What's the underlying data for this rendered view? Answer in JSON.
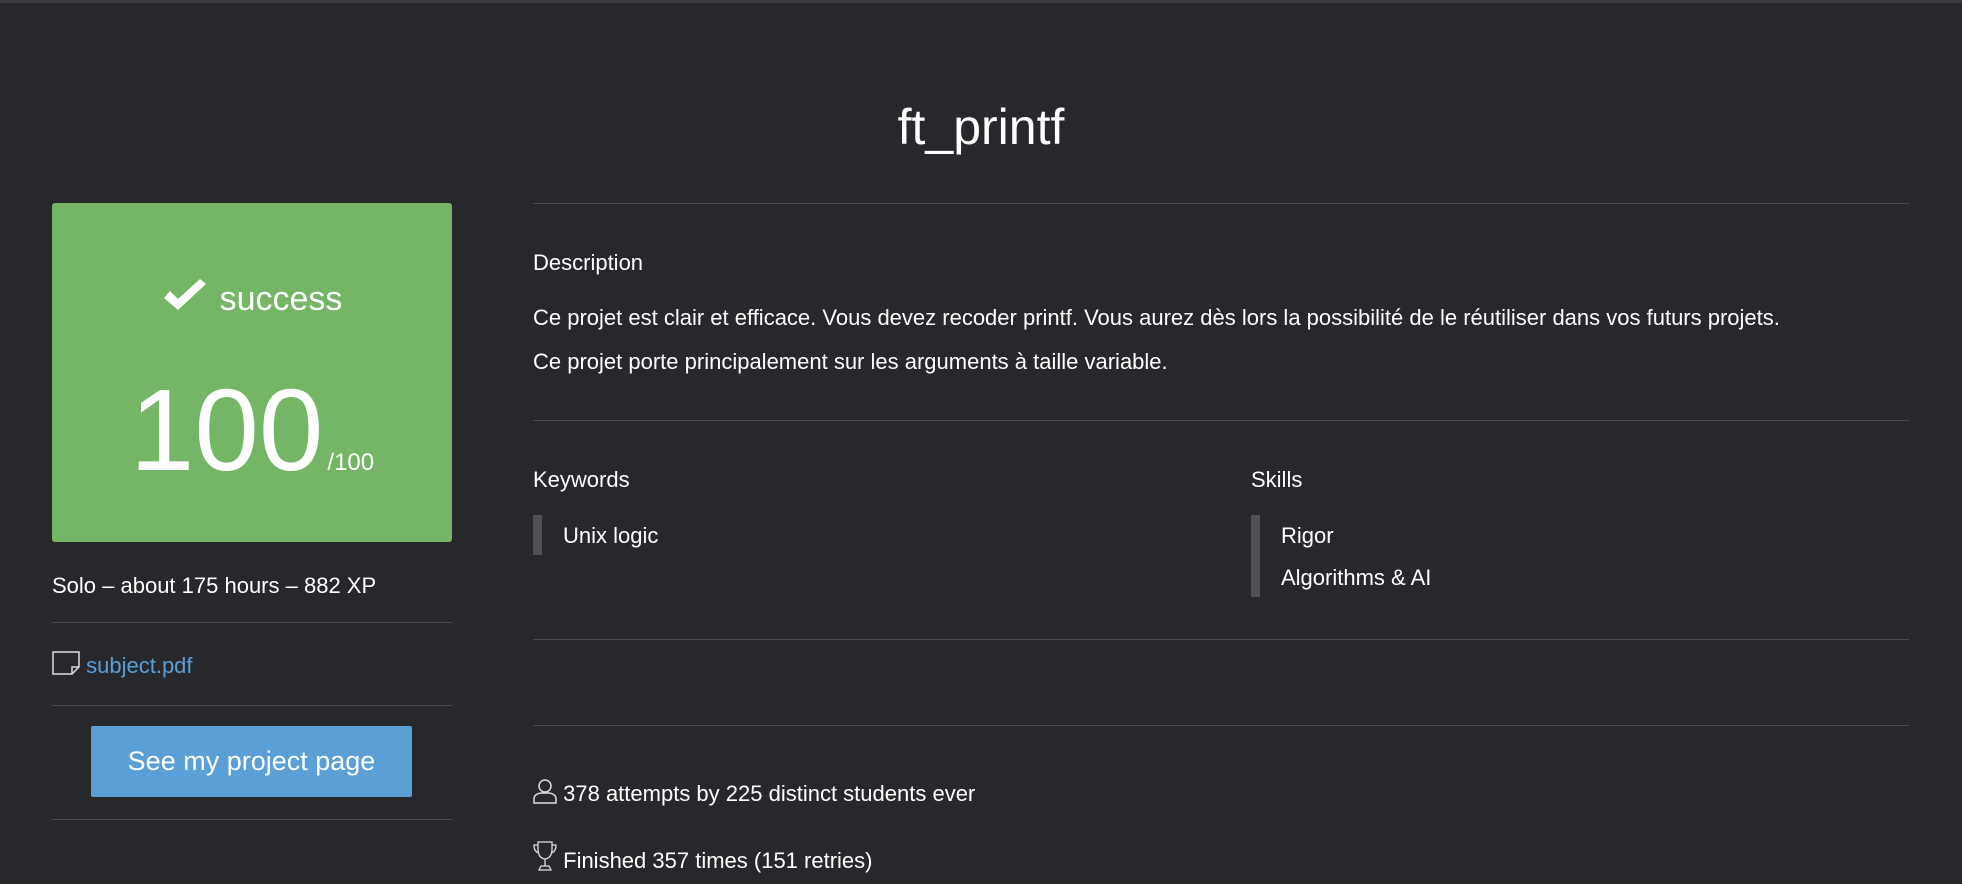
{
  "project": {
    "title": "ft_printf"
  },
  "result": {
    "status": "success",
    "score": "100",
    "max_score": "/100",
    "color": "#74b566"
  },
  "meta": {
    "text": "Solo – about 175 hours – 882 XP"
  },
  "subject": {
    "label": "subject.pdf"
  },
  "actions": {
    "project_page": "See my project page"
  },
  "description": {
    "heading": "Description",
    "lines": [
      "Ce projet est clair et efficace. Vous devez recoder printf. Vous aurez dès lors la possibilité de le réutiliser dans vos futurs projets.",
      "Ce projet porte principalement sur les arguments à taille variable."
    ]
  },
  "keywords": {
    "heading": "Keywords",
    "items": [
      "Unix logic"
    ]
  },
  "skills": {
    "heading": "Skills",
    "items": [
      "Rigor",
      "Algorithms & AI"
    ]
  },
  "stats": {
    "attempts": "378 attempts by 225 distinct students ever",
    "finished": "Finished 357 times (151 retries)"
  }
}
